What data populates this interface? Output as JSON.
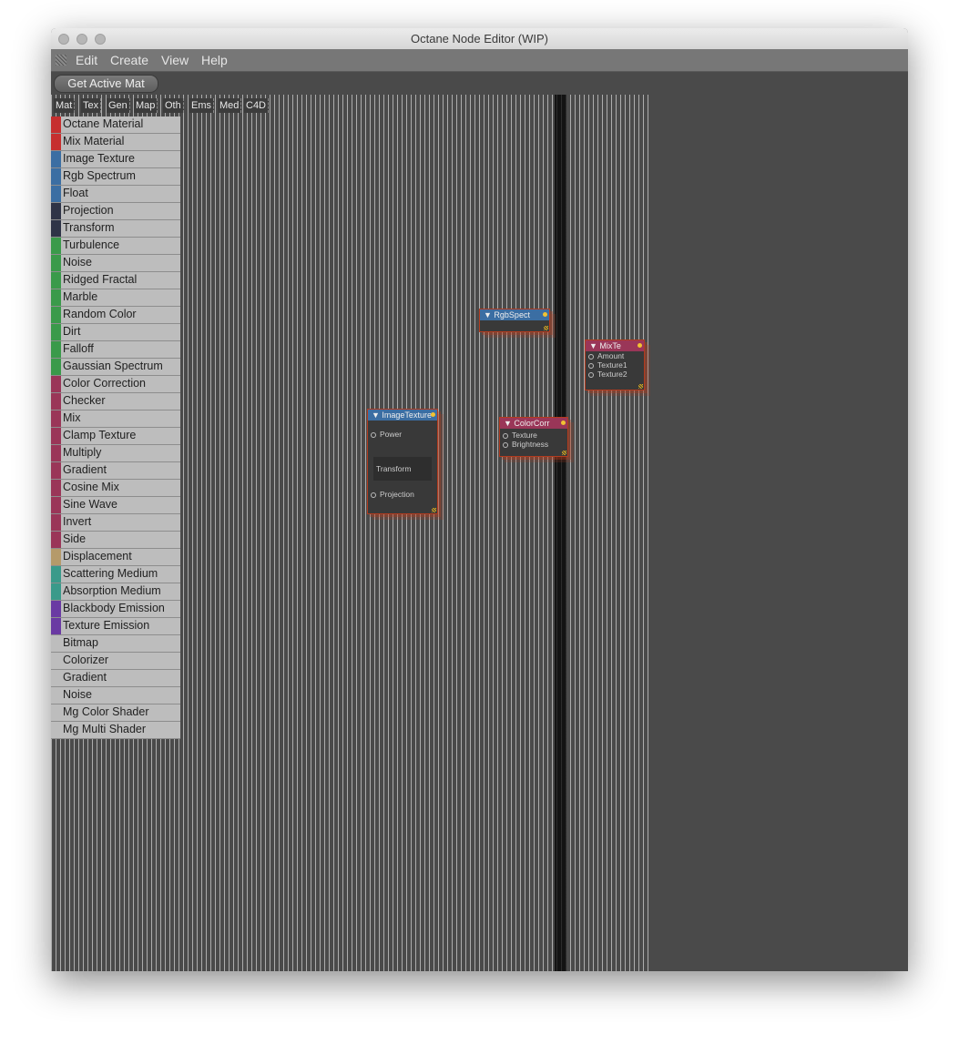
{
  "window": {
    "title": "Octane Node Editor (WIP)"
  },
  "menubar": {
    "items": [
      "Edit",
      "Create",
      "View",
      "Help"
    ]
  },
  "toolbar": {
    "get_active_mat": "Get Active Mat"
  },
  "tabs": [
    "Mat",
    "Tex",
    "Gen",
    "Map",
    "Oth",
    "Ems",
    "Med",
    "C4D"
  ],
  "node_list": [
    {
      "label": "Octane Material",
      "color": "#c62f2f"
    },
    {
      "label": "Mix Material",
      "color": "#c62f2f"
    },
    {
      "label": "Image Texture",
      "color": "#3b6ea3"
    },
    {
      "label": "Rgb Spectrum",
      "color": "#3b6ea3"
    },
    {
      "label": "Float",
      "color": "#3b6ea3"
    },
    {
      "label": "Projection",
      "color": "#2f3447"
    },
    {
      "label": "Transform",
      "color": "#2f3447"
    },
    {
      "label": "Turbulence",
      "color": "#3a9a4a"
    },
    {
      "label": "Noise",
      "color": "#3a9a4a"
    },
    {
      "label": "Ridged Fractal",
      "color": "#3a9a4a"
    },
    {
      "label": "Marble",
      "color": "#3a9a4a"
    },
    {
      "label": "Random Color",
      "color": "#3a9a4a"
    },
    {
      "label": "Dirt",
      "color": "#3a9a4a"
    },
    {
      "label": "Falloff",
      "color": "#3a9a4a"
    },
    {
      "label": "Gaussian Spectrum",
      "color": "#3a9a4a"
    },
    {
      "label": "Color Correction",
      "color": "#9a3658"
    },
    {
      "label": "Checker",
      "color": "#9a3658"
    },
    {
      "label": "Mix",
      "color": "#9a3658"
    },
    {
      "label": "Clamp Texture",
      "color": "#9a3658"
    },
    {
      "label": "Multiply",
      "color": "#9a3658"
    },
    {
      "label": "Gradient",
      "color": "#9a3658"
    },
    {
      "label": "Cosine Mix",
      "color": "#9a3658"
    },
    {
      "label": "Sine Wave",
      "color": "#9a3658"
    },
    {
      "label": "Invert",
      "color": "#9a3658"
    },
    {
      "label": "Side",
      "color": "#9a3658"
    },
    {
      "label": "Displacement",
      "color": "#b59a6a"
    },
    {
      "label": "Scattering Medium",
      "color": "#3a9a8a"
    },
    {
      "label": "Absorption Medium",
      "color": "#3a9a8a"
    },
    {
      "label": "Blackbody Emission",
      "color": "#6a3aa3"
    },
    {
      "label": "Texture Emission",
      "color": "#6a3aa3"
    },
    {
      "label": "Bitmap",
      "color": ""
    },
    {
      "label": "Colorizer",
      "color": ""
    },
    {
      "label": "Gradient",
      "color": ""
    },
    {
      "label": "Noise",
      "color": ""
    },
    {
      "label": "Mg Color Shader",
      "color": ""
    },
    {
      "label": "Mg Multi Shader",
      "color": ""
    }
  ],
  "graph_nodes": {
    "rgbspect": {
      "title": "RgbSpect",
      "header_color": "#3b6ea3"
    },
    "mixtex": {
      "title": "MixTe",
      "header_color": "#9a3658",
      "ports": [
        "Amount",
        "Texture1",
        "Texture2"
      ]
    },
    "imagetexture": {
      "title": "ImageTexture",
      "header_color": "#3b6ea3",
      "ports": [
        "Power",
        "Transform",
        "Projection"
      ]
    },
    "colorcorr": {
      "title": "ColorCorr",
      "header_color": "#9a3658",
      "ports": [
        "Texture",
        "Brightness"
      ]
    }
  }
}
